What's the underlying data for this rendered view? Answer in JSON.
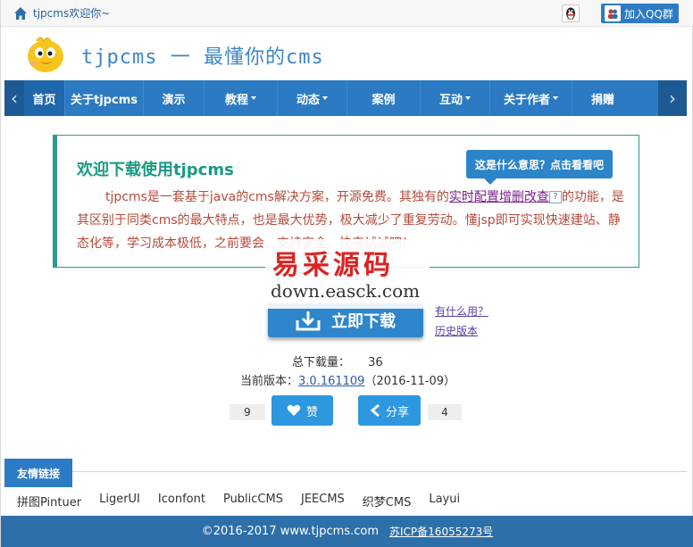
{
  "topbar": {
    "welcome": "tjpcms欢迎你~",
    "qq_group_label": "加入QQ群"
  },
  "header": {
    "title": "tjpcms 一 最懂你的cms"
  },
  "nav": {
    "items": [
      {
        "label": "首页"
      },
      {
        "label": "关于tjpcms"
      },
      {
        "label": "演示"
      },
      {
        "label": "教程"
      },
      {
        "label": "动态"
      },
      {
        "label": "案例"
      },
      {
        "label": "互动"
      },
      {
        "label": "关于作者"
      },
      {
        "label": "捐赠"
      }
    ]
  },
  "notice": {
    "title": "欢迎下载使用tjpcms",
    "tooltip": "这是什么意思？点击看看吧",
    "text_before": "tjpcms是一套基于java的cms解决方案，开源免费。其独有的",
    "link": "实时配置增删改查",
    "text_after": "的功能，是其区别于同类cms的最大特点，也是最大优势，极大减少了重复劳动。懂jsp即可实现快速建站、静态化等，学习成本极低，之前要会，支持安全，快来试试吧！"
  },
  "watermark": {
    "cn": "易采源码",
    "en": "down.easck.com"
  },
  "download": {
    "button": "立即下载",
    "link_what": "有什么用？",
    "link_history": "历史版本",
    "total_label": "总下载量：",
    "total_value": "36",
    "version_label": "当前版本：",
    "version_value": "3.0.161109",
    "version_date": "（2016-11-09）"
  },
  "social": {
    "like_count": "9",
    "like_label": "赞",
    "share_label": "分享",
    "share_count": "4"
  },
  "friend_links": {
    "heading": "友情链接",
    "items": [
      "拼图Pintuer",
      "LigerUI",
      "Iconfont",
      "PublicCMS",
      "JEECMS",
      "织梦CMS",
      "Layui"
    ]
  },
  "footer": {
    "copyright": "©2016-2017 www.tjpcms.com",
    "icp": "苏ICP备16055273号"
  },
  "colors": {
    "nav_bg": "#2c7ac1",
    "accent_teal": "#1a9a83",
    "notice_text": "#b54a3a",
    "footer_bg": "#2d6fa8"
  }
}
